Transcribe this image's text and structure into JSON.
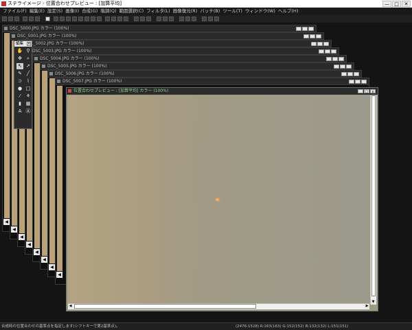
{
  "window": {
    "title": "ステライメージ - 位置合わせプレビュー : [加算平均]",
    "controls": [
      "—",
      "□",
      "✕"
    ]
  },
  "menu": [
    "ファイル(F)",
    "編集(E)",
    "設定(S)",
    "画像(I)",
    "合成(G)",
    "階調(Q)",
    "範囲選択(C)",
    "フィルタ(L)",
    "画像復元(R)",
    "バッチ(B)",
    "ツール(T)",
    "ウィンドウ(W)",
    "ヘルプ(H)"
  ],
  "documents": [
    "DSC_5000.JPG カラー (100%)",
    "DSC_5001.JPG カラー (100%)",
    "DSC_5002.JPG カラー (100%)",
    "DSC_5003.JPG カラー (100%)",
    "DSC_5004.JPG カラー (100%)",
    "DSC_5005.JPG カラー (100%)",
    "DSC_5006.JPG カラー (100%)",
    "DSC_5007.JPG カラー (100%)"
  ],
  "preview": {
    "title": "位置合わせプレビュー : [加算平均] カラー (100%)",
    "accent": "#8fd18f"
  },
  "tool_palette": {
    "title": "編集",
    "tools": [
      {
        "name": "hand-icon",
        "glyph": "✋"
      },
      {
        "name": "zoom-icon",
        "glyph": "⚲"
      },
      {
        "name": "move-icon",
        "glyph": "✥"
      },
      {
        "name": "eyedropper-icon",
        "glyph": "⌕"
      },
      {
        "name": "select-arrow-icon",
        "glyph": "↖"
      },
      {
        "name": "pointer-icon",
        "glyph": "➚"
      },
      {
        "name": "pencil-icon",
        "glyph": "✎"
      },
      {
        "name": "line-icon",
        "glyph": "╱"
      },
      {
        "name": "lasso-icon",
        "glyph": "⊃"
      },
      {
        "name": "brush-icon",
        "glyph": "⌇"
      },
      {
        "name": "spot-icon",
        "glyph": "●"
      },
      {
        "name": "rect-select-icon",
        "glyph": "□"
      },
      {
        "name": "wand-icon",
        "glyph": "⁄"
      },
      {
        "name": "stamp-icon",
        "glyph": "⚘"
      },
      {
        "name": "bucket-icon",
        "glyph": "▮"
      },
      {
        "name": "gradient-icon",
        "glyph": "▦"
      },
      {
        "name": "text-icon",
        "glyph": "A"
      },
      {
        "name": "text-box-icon",
        "glyph": "Ⓐ"
      }
    ],
    "selected": "select-arrow-icon"
  },
  "status": {
    "hint": "合成時の位置合わせの基準点を指定します(シフトキーで第2基準点)。",
    "readout": "(2476:1528) R:163(163) G:152(152) B:132(132) L:151(151)"
  }
}
